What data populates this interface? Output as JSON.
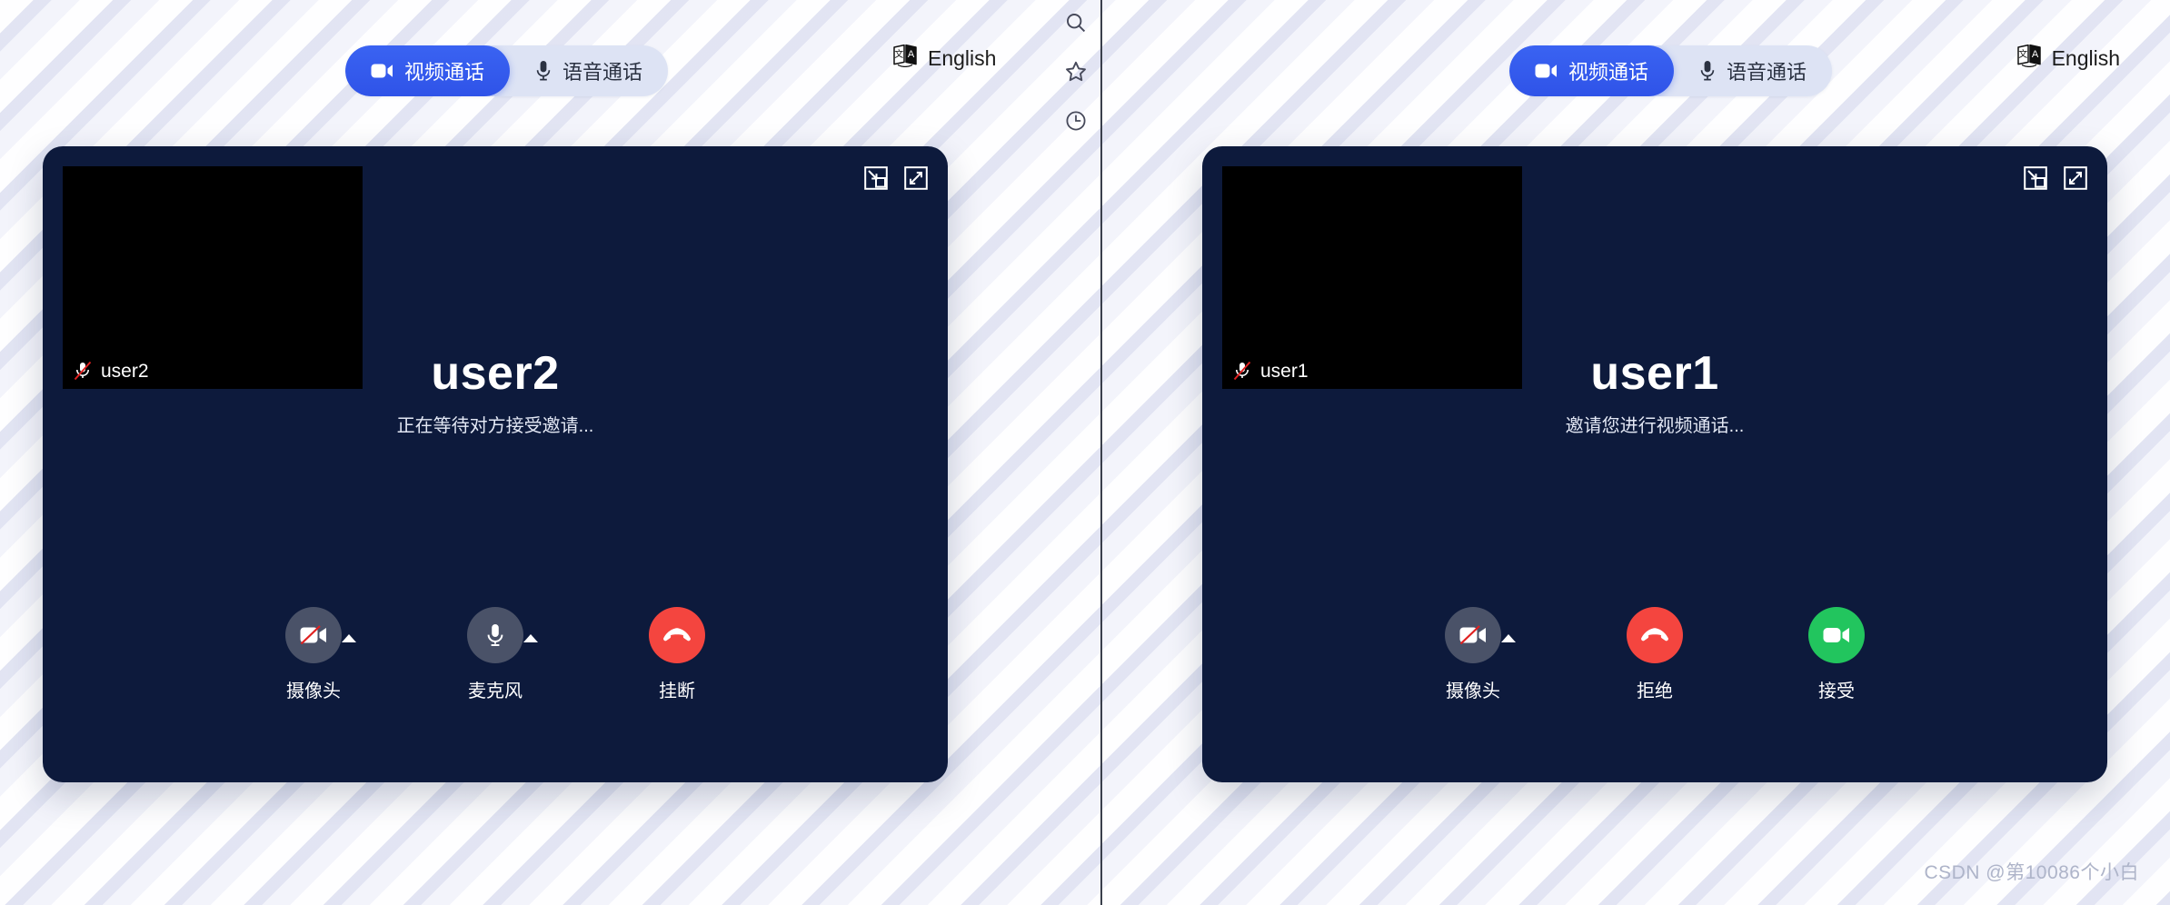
{
  "watermark": "CSDN @第10086个小白",
  "rail": {
    "items": [
      {
        "name": "search-icon",
        "label": "Search"
      },
      {
        "name": "star-icon",
        "label": "Favorites"
      },
      {
        "name": "history-icon",
        "label": "History"
      }
    ]
  },
  "colors": {
    "accent_blue": "#2f53e8",
    "segment_bg": "#dde3f4",
    "panel_navy": "#0d1a3c",
    "danger_red": "#f4453f",
    "success_green": "#22c55e",
    "neutral_gray": "#4a5268",
    "page_bg": "#f2f3fa"
  },
  "left": {
    "tabs": [
      {
        "id": "video",
        "label": "视频通话",
        "icon": "video-camera-icon",
        "active": true
      },
      {
        "id": "audio",
        "label": "语音通话",
        "icon": "microphone-icon",
        "active": false
      }
    ],
    "language": {
      "label": "English",
      "icon": "translate-icon"
    },
    "panel_tools": [
      {
        "name": "picture-in-picture-icon",
        "label": "画中画"
      },
      {
        "name": "fullscreen-icon",
        "label": "全屏"
      }
    ],
    "selfview": {
      "name": "user2",
      "mic_icon": "microphone-muted-icon"
    },
    "peer": {
      "name": "user2",
      "status": "正在等待对方接受邀请..."
    },
    "controls": [
      {
        "id": "camera",
        "label": "摄像头",
        "icon": "camera-off-icon",
        "style": "neutral",
        "caret": true
      },
      {
        "id": "mic",
        "label": "麦克风",
        "icon": "microphone-icon",
        "style": "neutral",
        "caret": true
      },
      {
        "id": "hangup",
        "label": "挂断",
        "icon": "phone-hangup-icon",
        "style": "danger",
        "caret": false
      }
    ]
  },
  "right": {
    "tabs": [
      {
        "id": "video",
        "label": "视频通话",
        "icon": "video-camera-icon",
        "active": true
      },
      {
        "id": "audio",
        "label": "语音通话",
        "icon": "microphone-icon",
        "active": false
      }
    ],
    "language": {
      "label": "English",
      "icon": "translate-icon"
    },
    "panel_tools": [
      {
        "name": "picture-in-picture-icon",
        "label": "画中画"
      },
      {
        "name": "fullscreen-icon",
        "label": "全屏"
      }
    ],
    "selfview": {
      "name": "user1",
      "mic_icon": "microphone-muted-icon"
    },
    "peer": {
      "name": "user1",
      "status": "邀请您进行视频通话..."
    },
    "controls": [
      {
        "id": "camera",
        "label": "摄像头",
        "icon": "camera-off-icon",
        "style": "neutral",
        "caret": true
      },
      {
        "id": "reject",
        "label": "拒绝",
        "icon": "phone-hangup-icon",
        "style": "danger",
        "caret": false
      },
      {
        "id": "accept",
        "label": "接受",
        "icon": "video-camera-icon",
        "style": "success",
        "caret": false
      }
    ]
  }
}
